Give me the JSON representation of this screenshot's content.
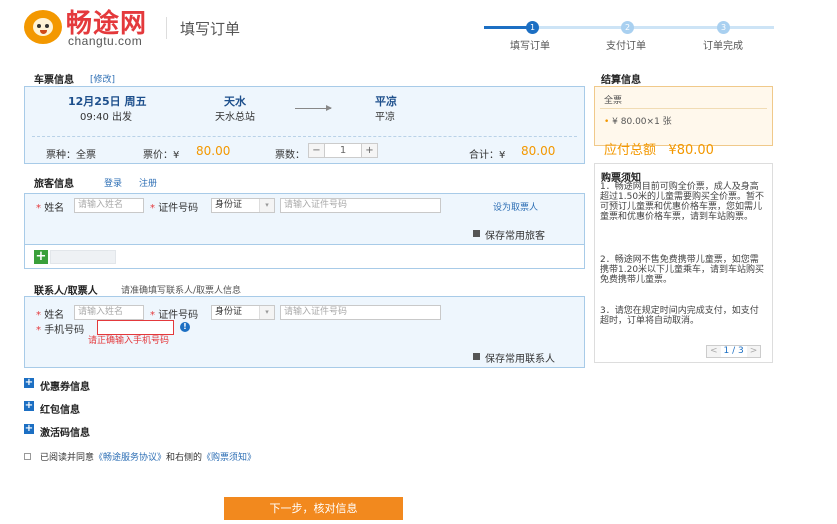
{
  "header": {
    "logo_cn": "畅途网",
    "logo_en": "changtu.com",
    "page_title": "填写订单",
    "steps": [
      {
        "num": "1",
        "label": "填写订单"
      },
      {
        "num": "2",
        "label": "支付订单"
      },
      {
        "num": "3",
        "label": "订单完成"
      }
    ]
  },
  "ticket": {
    "section_title": "车票信息",
    "edit_link": "[修改]",
    "date": "12月25日  周五",
    "time": "09:40  出发",
    "from_city": "天水",
    "from_station": "天水总站",
    "to_city": "平凉",
    "to_station": "平凉",
    "type_label": "票种：全票",
    "price_label": "票价：¥",
    "price_value": "80.00",
    "qty_label": "票数：",
    "qty_minus": "−",
    "qty_value": "1",
    "qty_plus": "+",
    "total_label": "合计：¥",
    "total_value": "80.00"
  },
  "passenger": {
    "section_title": "旅客信息",
    "login_link": "登录",
    "register_link": "注册",
    "name_label": "姓名",
    "name_placeholder": "请输入姓名",
    "id_label": "证件号码",
    "id_type": "身份证",
    "id_placeholder": "请输入证件号码",
    "set_taker_link": "设为取票人",
    "save_label": "保存常用旅客",
    "add_icon": "+"
  },
  "contact": {
    "section_title": "联系人/取票人",
    "hint": "请准确填写联系人/取票人信息",
    "name_label": "姓名",
    "name_placeholder": "请输入姓名",
    "id_label": "证件号码",
    "id_type": "身份证",
    "id_placeholder": "请输入证件号码",
    "phone_label": "手机号码",
    "phone_value": "",
    "phone_error": "请正确输入手机号码",
    "info_icon": "!",
    "save_label": "保存常用联系人"
  },
  "extras": [
    {
      "icon": "+",
      "label": "优惠券信息"
    },
    {
      "icon": "+",
      "label": "红包信息"
    },
    {
      "icon": "+",
      "label": "激活码信息"
    }
  ],
  "agreement": {
    "prefix": "已阅读并同意",
    "link1": "《畅途服务协议》",
    "middle": "和右侧的",
    "link2": "《购票须知》"
  },
  "settlement": {
    "title": "结算信息",
    "ticket_type": "全票",
    "line_item": "¥ 80.00×1 张",
    "total_label": "应付总额",
    "total_value": "¥80.00"
  },
  "notice": {
    "title": "购票须知",
    "items": [
      "1．畅途网目前可购全价票，成人及身高超过1.50米的儿童需要购买全价票。暂不可预订儿童票和优惠价格车票，您如需儿童票和优惠价格车票，请到车站购票。",
      "2．畅途网不售免费携带儿童票，如您需携带1.20米以下儿童乘车，请到车站购买免费携带儿童票。",
      "3．请您在规定时间内完成支付，如支付超时，订单将自动取消。"
    ],
    "pager_prev": "<",
    "pager_text": "1 / 3",
    "pager_next": ">"
  },
  "next_button": "下一步，核对信息",
  "colors": {
    "brand_orange": "#f39800",
    "brand_blue": "#1c6fc3",
    "error_red": "#e4393c"
  }
}
